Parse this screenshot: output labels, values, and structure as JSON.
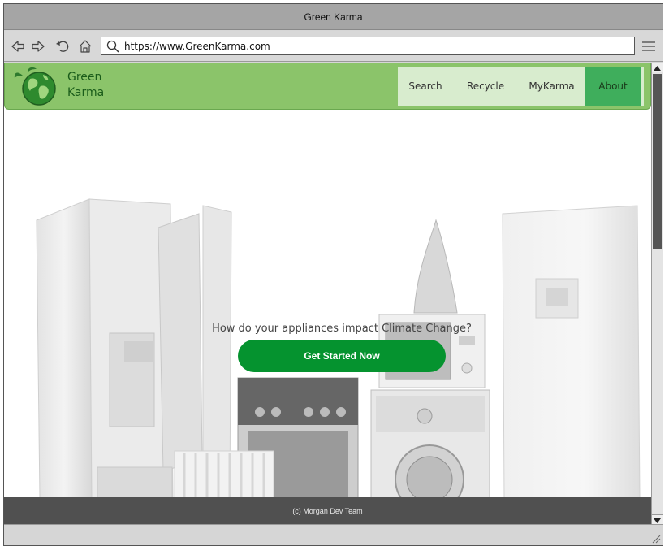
{
  "window": {
    "title": "Green Karma"
  },
  "toolbar": {
    "url": "https://www.GreenKarma.com",
    "icons": [
      "back-icon",
      "forward-icon",
      "reload-icon",
      "home-icon",
      "search-icon",
      "hamburger-menu-icon"
    ]
  },
  "site": {
    "brand_line1": "Green",
    "brand_line2": "Karma",
    "nav": [
      {
        "label": "Search",
        "active": false
      },
      {
        "label": "Recycle",
        "active": false
      },
      {
        "label": "MyKarma",
        "active": false
      },
      {
        "label": "About",
        "active": true
      }
    ],
    "hero": {
      "headline": "How do your appliances impact Climate Change?",
      "cta_label": "Get Started Now"
    },
    "footer": "(c) Morgan Dev Team"
  },
  "colors": {
    "header_green": "#8bc46a",
    "nav_active": "#3fae5c",
    "cta_green": "#05932f",
    "footer_gray": "#505050"
  }
}
